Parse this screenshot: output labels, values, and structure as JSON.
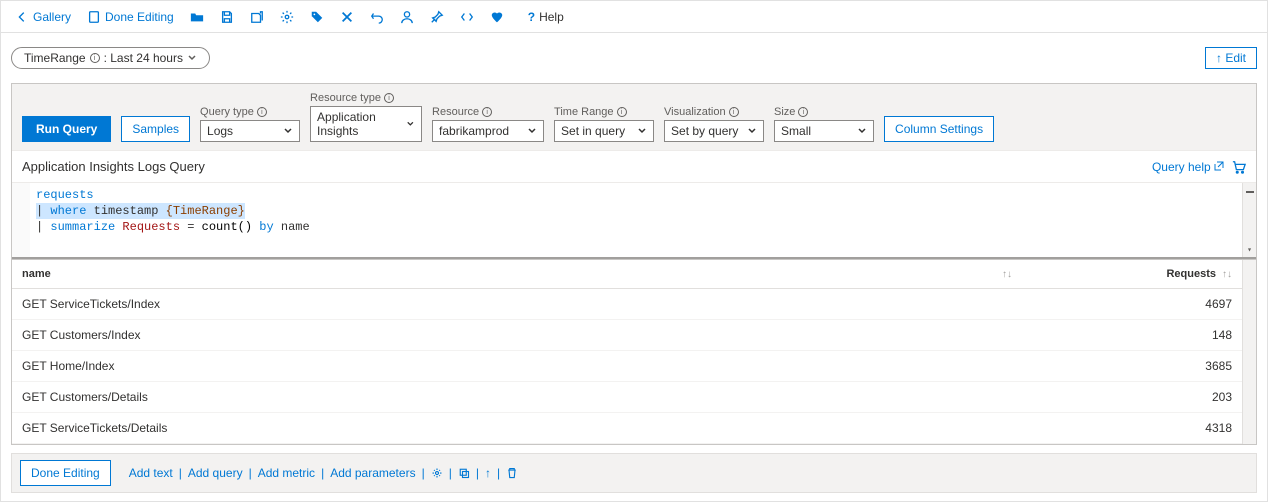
{
  "topbar": {
    "gallery": "Gallery",
    "done_editing": "Done Editing",
    "help": "Help"
  },
  "param_pill": {
    "prefix": "TimeRange",
    "suffix": ": Last 24 hours"
  },
  "top_edit_btn": "↑ Edit",
  "qtool": {
    "run": "Run Query",
    "samples": "Samples",
    "labels": {
      "querytype": "Query type",
      "restype": "Resource type",
      "resource": "Resource",
      "timerange": "Time Range",
      "viz": "Visualization",
      "size": "Size"
    },
    "values": {
      "querytype": "Logs",
      "restype": "Application Insights",
      "resource": "fabrikamprod",
      "timerange": "Set in query",
      "viz": "Set by query",
      "size": "Small"
    },
    "col_settings": "Column Settings"
  },
  "editor": {
    "title": "Application Insights Logs Query",
    "help": "Query help",
    "line1_table": "requests",
    "line2_where": "where",
    "line2_ts": "timestamp",
    "line2_tok": "{TimeRange}",
    "line3_sum": "summarize",
    "line3_col": "Requests",
    "line3_eq": " = ",
    "line3_fn": "count()",
    "line3_by": "by",
    "line3_name": "name"
  },
  "results": {
    "headers": {
      "name": "name",
      "requests": "Requests"
    },
    "rows": [
      {
        "name": "GET ServiceTickets/Index",
        "requests": 4697
      },
      {
        "name": "GET Customers/Index",
        "requests": 148
      },
      {
        "name": "GET Home/Index",
        "requests": 3685
      },
      {
        "name": "GET Customers/Details",
        "requests": 203
      },
      {
        "name": "GET ServiceTickets/Details",
        "requests": 4318
      }
    ]
  },
  "footer": {
    "done_editing": "Done Editing",
    "add_text": "Add text",
    "add_query": "Add query",
    "add_metric": "Add metric",
    "add_params": "Add parameters"
  }
}
